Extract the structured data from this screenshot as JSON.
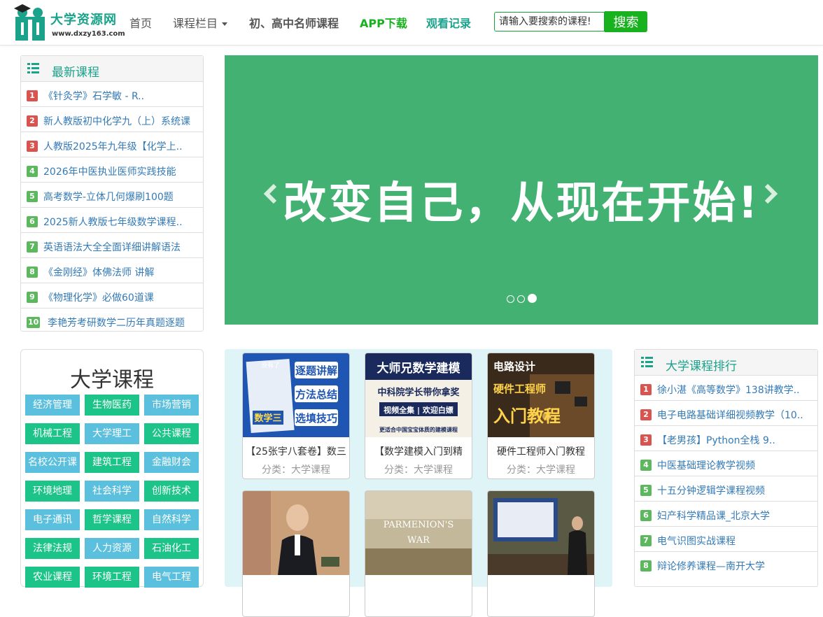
{
  "nav": {
    "logo_text": "大学资源网",
    "logo_domain": "www.dxzy163.com",
    "home": "首页",
    "columns": "课程栏目",
    "teachers": "初、高中名师课程",
    "app": "APP下载",
    "history": "观看记录",
    "search_placeholder": "请输入要搜索的课程!",
    "search_button": "搜索"
  },
  "latest": {
    "title": "最新课程",
    "items": [
      {
        "n": "1",
        "text": "《针灸学》石学敏 - R.."
      },
      {
        "n": "2",
        "text": "新人教版初中化学九（上）系统课"
      },
      {
        "n": "3",
        "text": "人教版2025年九年级【化学上.."
      },
      {
        "n": "4",
        "text": "2026年中医执业医师实践技能"
      },
      {
        "n": "5",
        "text": "高考数学-立体几何爆刷100题"
      },
      {
        "n": "6",
        "text": "2025新人教版七年级数学课程.."
      },
      {
        "n": "7",
        "text": "英语语法大全全面详细讲解语法"
      },
      {
        "n": "8",
        "text": "《金刚经》体佛法师 讲解"
      },
      {
        "n": "9",
        "text": "《物理化学》必做60道课"
      },
      {
        "n": "10",
        "text": "李艳芳考研数学二历年真题逐题"
      }
    ]
  },
  "banner": {
    "slogan": "改变自己，从现在开始!"
  },
  "categories": {
    "title": "大学课程",
    "tags": [
      "经济管理",
      "生物医药",
      "市场营销",
      "机械工程",
      "大学理工",
      "公共课程",
      "名校公开课",
      "建筑工程",
      "金融财会",
      "环境地理",
      "社会科学",
      "创新技术",
      "电子通讯",
      "哲学课程",
      "自然科学",
      "法律法规",
      "人力资源",
      "石油化工",
      "农业课程",
      "环境工程",
      "电气工程"
    ]
  },
  "cards": [
    {
      "title": "【25张宇八套卷】数三",
      "category": "分类：大学课程",
      "img_lines": [
        "没有了",
        "逐题讲解",
        "方法总结",
        "选填技巧",
        "数学三"
      ]
    },
    {
      "title": "【数学建模入门到精",
      "category": "分类：大学课程",
      "img_lines": [
        "大师兄数学建模",
        "中科院学长带你拿奖",
        "视频全集 | 欢迎白嫖",
        "更适合中国宝宝体质的建模课程"
      ]
    },
    {
      "title": "硬件工程师入门教程",
      "category": "分类：大学课程",
      "img_lines": [
        "电路设计",
        "硬件工程师",
        "入门教程"
      ]
    },
    {
      "title": "",
      "category": "",
      "img_lines": []
    },
    {
      "title": "",
      "category": "",
      "img_lines": [
        "PARMENION'S",
        "WAR"
      ]
    },
    {
      "title": "",
      "category": "",
      "img_lines": []
    }
  ],
  "ranking": {
    "title": "大学课程排行",
    "items": [
      {
        "n": "1",
        "text": "徐小湛《高等数学》138讲教学.."
      },
      {
        "n": "2",
        "text": "电子电路基础详细视频教学（10.."
      },
      {
        "n": "3",
        "text": "【老男孩】Python全栈 9.."
      },
      {
        "n": "4",
        "text": "中医基础理论教学视频"
      },
      {
        "n": "5",
        "text": "十五分钟逻辑学课程视频"
      },
      {
        "n": "6",
        "text": "妇产科学精品课_北京大学"
      },
      {
        "n": "7",
        "text": "电气识图实战课程"
      },
      {
        "n": "8",
        "text": "辩论修养课程—南开大学"
      }
    ]
  }
}
